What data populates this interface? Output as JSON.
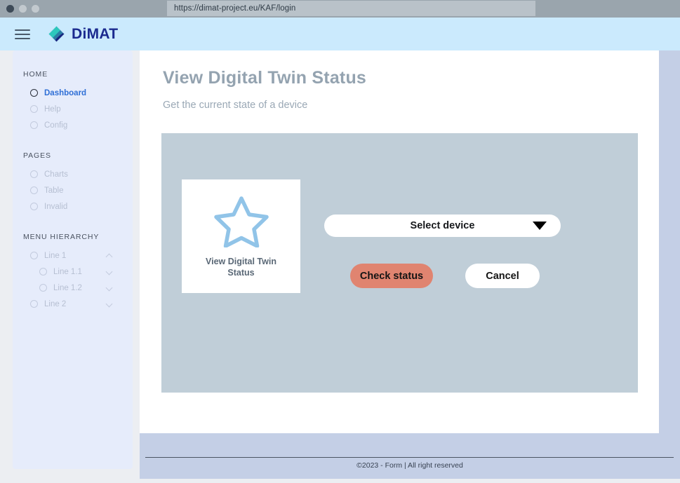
{
  "browser": {
    "url": "https://dimat-project.eu/KAF/login",
    "traffic_lights": [
      "close-dot",
      "minimize-dot",
      "maximize-dot"
    ]
  },
  "header": {
    "menu_icon": "hamburger-menu-icon",
    "logo_icon": "dimat-diamond-logo-icon",
    "brand": "DiMAT",
    "brand_color": "#1b2b8f",
    "background_color": "#cbeafd"
  },
  "sidebar": {
    "groups": [
      {
        "title": "HOME",
        "items": [
          {
            "label": "Dashboard",
            "active": true,
            "chevron": ""
          },
          {
            "label": "Help",
            "active": false,
            "chevron": ""
          },
          {
            "label": "Config",
            "active": false,
            "chevron": ""
          }
        ]
      },
      {
        "title": "PAGES",
        "items": [
          {
            "label": "Charts",
            "active": false,
            "chevron": ""
          },
          {
            "label": "Table",
            "active": false,
            "chevron": ""
          },
          {
            "label": "Invalid",
            "active": false,
            "chevron": ""
          }
        ]
      },
      {
        "title": "MENU HIERARCHY",
        "items": [
          {
            "label": "Line 1",
            "active": false,
            "chevron": "up",
            "indent": false
          },
          {
            "label": "Line 1.1",
            "active": false,
            "chevron": "down",
            "indent": true
          },
          {
            "label": "Line 1.2",
            "active": false,
            "chevron": "down",
            "indent": true
          },
          {
            "label": "Line 2",
            "active": false,
            "chevron": "down",
            "indent": false
          }
        ]
      }
    ],
    "active_color": "#2f6fd6",
    "background_color": "#e6ecfb"
  },
  "main": {
    "title": "View Digital Twin Status",
    "subtitle": "Get the current state of a device",
    "panel_color": "#c0ced8",
    "tile": {
      "icon": "star-outline-icon",
      "icon_color": "#91c4e8",
      "label": "View Digital Twin Status"
    },
    "select_device": {
      "value": "Select device",
      "caret_icon": "chevron-down-icon"
    },
    "buttons": {
      "primary_label": "Check status",
      "primary_color": "#e08470",
      "secondary_label": "Cancel",
      "secondary_color": "#ffffff"
    }
  },
  "footer": {
    "text": "©2023 - Form |  All right reserved",
    "background_color": "#c4cfe6"
  }
}
